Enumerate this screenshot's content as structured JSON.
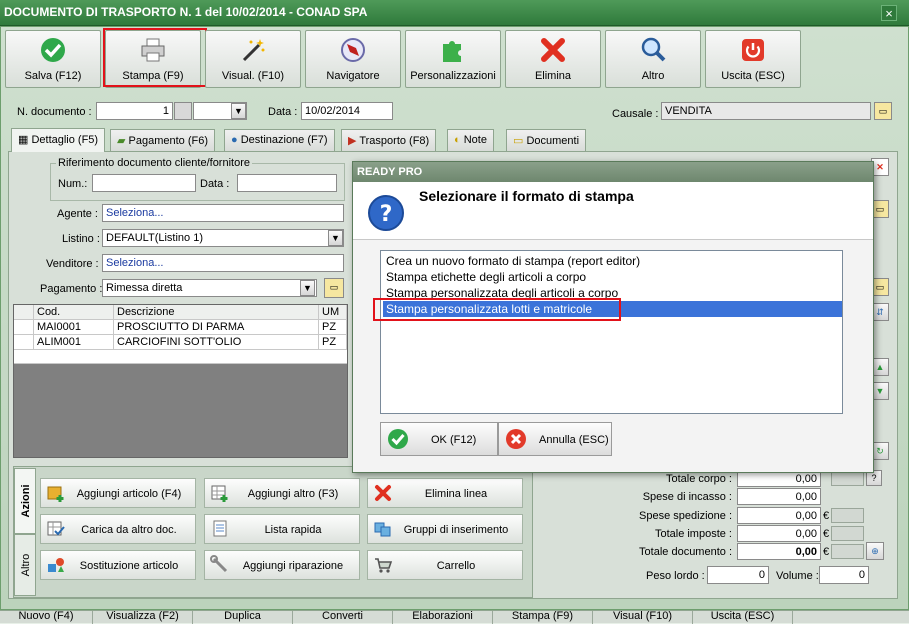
{
  "window": {
    "title": "DOCUMENTO DI TRASPORTO N. 1 del 10/02/2014 - CONAD SPA",
    "close": "×"
  },
  "toolbar": {
    "save": "Salva (F12)",
    "print": "Stampa (F9)",
    "view": "Visual. (F10)",
    "navigator": "Navigatore",
    "custom": "Personalizzazioni",
    "delete": "Elimina",
    "other": "Altro",
    "exit": "Uscita (ESC)"
  },
  "header": {
    "doc_number_label": "N. documento :",
    "doc_number": "1",
    "date_label": "Data :",
    "date": "10/02/2014",
    "causale_label": "Causale :",
    "causale": "VENDITA"
  },
  "tabs": [
    "Dettaglio (F5)",
    "Pagamento (F6)",
    "Destinazione (F7)",
    "Trasporto (F8)",
    "Note",
    "Documenti"
  ],
  "detail": {
    "ref_group": "Riferimento documento cliente/fornitore",
    "num_label": "Num.:",
    "data_label": "Data :",
    "agent_label": "Agente :",
    "agent_value": "Seleziona...",
    "listino_label": "Listino :",
    "listino_value": "DEFAULT(Listino 1)",
    "seller_label": "Venditore :",
    "seller_value": "Seleziona...",
    "payment_label": "Pagamento :",
    "payment_value": "Rimessa diretta"
  },
  "grid": {
    "columns": [
      "Cod.",
      "Descrizione",
      "UM"
    ],
    "rows": [
      [
        "MAI0001",
        "PROSCIUTTO DI PARMA",
        "PZ"
      ],
      [
        "ALIM001",
        "CARCIOFINI SOTT'OLIO",
        "PZ"
      ]
    ]
  },
  "actions": {
    "side_tabs": [
      "Azioni",
      "Altro"
    ],
    "buttons": [
      "Aggiungi articolo (F4)",
      "Aggiungi altro (F3)",
      "Elimina linea",
      "Carica da altro doc.",
      "Lista rapida",
      "Gruppi di inserimento",
      "Sostituzione articolo",
      "Aggiungi riparazione",
      "Carrello"
    ]
  },
  "totals": {
    "corpo_label": "Totale corpo :",
    "corpo": "0,00",
    "incasso_label": "Spese di incasso :",
    "incasso": "0,00",
    "spedizione_label": "Spese spedizione :",
    "spedizione": "0,00",
    "imposte_label": "Totale imposte :",
    "imposte": "0,00",
    "documento_label": "Totale documento :",
    "documento": "0,00",
    "currency": "€",
    "peso_label": "Peso lordo :",
    "peso": "0",
    "volume_label": "Volume :",
    "volume": "0",
    "help": "?"
  },
  "bottombar": [
    "Nuovo (F4)",
    "Visualizza (F2)",
    "Duplica",
    "Converti",
    "Elaborazioni",
    "Stampa (F9)",
    "Visual (F10)",
    "Uscita (ESC)"
  ],
  "dialog": {
    "title": "READY PRO",
    "heading": "Selezionare il formato di stampa",
    "options": [
      "Crea un nuovo formato di stampa (report editor)",
      "Stampa etichette degli articoli a corpo",
      "Stampa personalizzata degli articoli a corpo",
      "Stampa personalizzata lotti e matricole"
    ],
    "selected_index": 3,
    "ok": "OK (F12)",
    "cancel": "Annulla (ESC)"
  },
  "colors": {
    "accent": "#2f7a3b",
    "highlight": "#e2121a",
    "selection": "#3b73d9"
  }
}
